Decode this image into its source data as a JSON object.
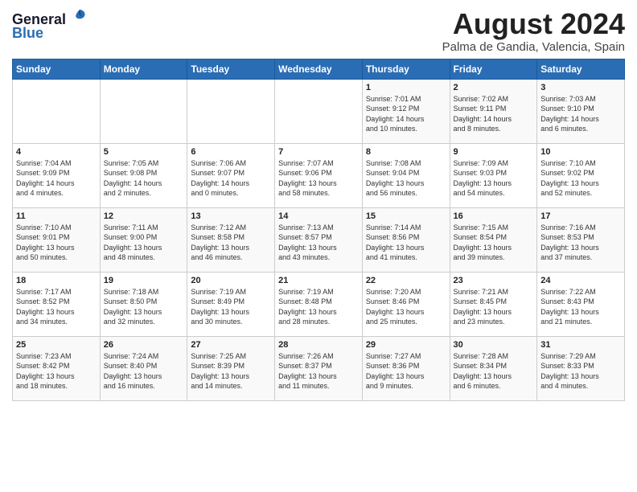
{
  "header": {
    "logo_line1": "General",
    "logo_line2": "Blue",
    "month_year": "August 2024",
    "location": "Palma de Gandia, Valencia, Spain"
  },
  "columns": [
    "Sunday",
    "Monday",
    "Tuesday",
    "Wednesday",
    "Thursday",
    "Friday",
    "Saturday"
  ],
  "weeks": [
    [
      {
        "day": "",
        "info": ""
      },
      {
        "day": "",
        "info": ""
      },
      {
        "day": "",
        "info": ""
      },
      {
        "day": "",
        "info": ""
      },
      {
        "day": "1",
        "info": "Sunrise: 7:01 AM\nSunset: 9:12 PM\nDaylight: 14 hours\nand 10 minutes."
      },
      {
        "day": "2",
        "info": "Sunrise: 7:02 AM\nSunset: 9:11 PM\nDaylight: 14 hours\nand 8 minutes."
      },
      {
        "day": "3",
        "info": "Sunrise: 7:03 AM\nSunset: 9:10 PM\nDaylight: 14 hours\nand 6 minutes."
      }
    ],
    [
      {
        "day": "4",
        "info": "Sunrise: 7:04 AM\nSunset: 9:09 PM\nDaylight: 14 hours\nand 4 minutes."
      },
      {
        "day": "5",
        "info": "Sunrise: 7:05 AM\nSunset: 9:08 PM\nDaylight: 14 hours\nand 2 minutes."
      },
      {
        "day": "6",
        "info": "Sunrise: 7:06 AM\nSunset: 9:07 PM\nDaylight: 14 hours\nand 0 minutes."
      },
      {
        "day": "7",
        "info": "Sunrise: 7:07 AM\nSunset: 9:06 PM\nDaylight: 13 hours\nand 58 minutes."
      },
      {
        "day": "8",
        "info": "Sunrise: 7:08 AM\nSunset: 9:04 PM\nDaylight: 13 hours\nand 56 minutes."
      },
      {
        "day": "9",
        "info": "Sunrise: 7:09 AM\nSunset: 9:03 PM\nDaylight: 13 hours\nand 54 minutes."
      },
      {
        "day": "10",
        "info": "Sunrise: 7:10 AM\nSunset: 9:02 PM\nDaylight: 13 hours\nand 52 minutes."
      }
    ],
    [
      {
        "day": "11",
        "info": "Sunrise: 7:10 AM\nSunset: 9:01 PM\nDaylight: 13 hours\nand 50 minutes."
      },
      {
        "day": "12",
        "info": "Sunrise: 7:11 AM\nSunset: 9:00 PM\nDaylight: 13 hours\nand 48 minutes."
      },
      {
        "day": "13",
        "info": "Sunrise: 7:12 AM\nSunset: 8:58 PM\nDaylight: 13 hours\nand 46 minutes."
      },
      {
        "day": "14",
        "info": "Sunrise: 7:13 AM\nSunset: 8:57 PM\nDaylight: 13 hours\nand 43 minutes."
      },
      {
        "day": "15",
        "info": "Sunrise: 7:14 AM\nSunset: 8:56 PM\nDaylight: 13 hours\nand 41 minutes."
      },
      {
        "day": "16",
        "info": "Sunrise: 7:15 AM\nSunset: 8:54 PM\nDaylight: 13 hours\nand 39 minutes."
      },
      {
        "day": "17",
        "info": "Sunrise: 7:16 AM\nSunset: 8:53 PM\nDaylight: 13 hours\nand 37 minutes."
      }
    ],
    [
      {
        "day": "18",
        "info": "Sunrise: 7:17 AM\nSunset: 8:52 PM\nDaylight: 13 hours\nand 34 minutes."
      },
      {
        "day": "19",
        "info": "Sunrise: 7:18 AM\nSunset: 8:50 PM\nDaylight: 13 hours\nand 32 minutes."
      },
      {
        "day": "20",
        "info": "Sunrise: 7:19 AM\nSunset: 8:49 PM\nDaylight: 13 hours\nand 30 minutes."
      },
      {
        "day": "21",
        "info": "Sunrise: 7:19 AM\nSunset: 8:48 PM\nDaylight: 13 hours\nand 28 minutes."
      },
      {
        "day": "22",
        "info": "Sunrise: 7:20 AM\nSunset: 8:46 PM\nDaylight: 13 hours\nand 25 minutes."
      },
      {
        "day": "23",
        "info": "Sunrise: 7:21 AM\nSunset: 8:45 PM\nDaylight: 13 hours\nand 23 minutes."
      },
      {
        "day": "24",
        "info": "Sunrise: 7:22 AM\nSunset: 8:43 PM\nDaylight: 13 hours\nand 21 minutes."
      }
    ],
    [
      {
        "day": "25",
        "info": "Sunrise: 7:23 AM\nSunset: 8:42 PM\nDaylight: 13 hours\nand 18 minutes."
      },
      {
        "day": "26",
        "info": "Sunrise: 7:24 AM\nSunset: 8:40 PM\nDaylight: 13 hours\nand 16 minutes."
      },
      {
        "day": "27",
        "info": "Sunrise: 7:25 AM\nSunset: 8:39 PM\nDaylight: 13 hours\nand 14 minutes."
      },
      {
        "day": "28",
        "info": "Sunrise: 7:26 AM\nSunset: 8:37 PM\nDaylight: 13 hours\nand 11 minutes."
      },
      {
        "day": "29",
        "info": "Sunrise: 7:27 AM\nSunset: 8:36 PM\nDaylight: 13 hours\nand 9 minutes."
      },
      {
        "day": "30",
        "info": "Sunrise: 7:28 AM\nSunset: 8:34 PM\nDaylight: 13 hours\nand 6 minutes."
      },
      {
        "day": "31",
        "info": "Sunrise: 7:29 AM\nSunset: 8:33 PM\nDaylight: 13 hours\nand 4 minutes."
      }
    ]
  ]
}
